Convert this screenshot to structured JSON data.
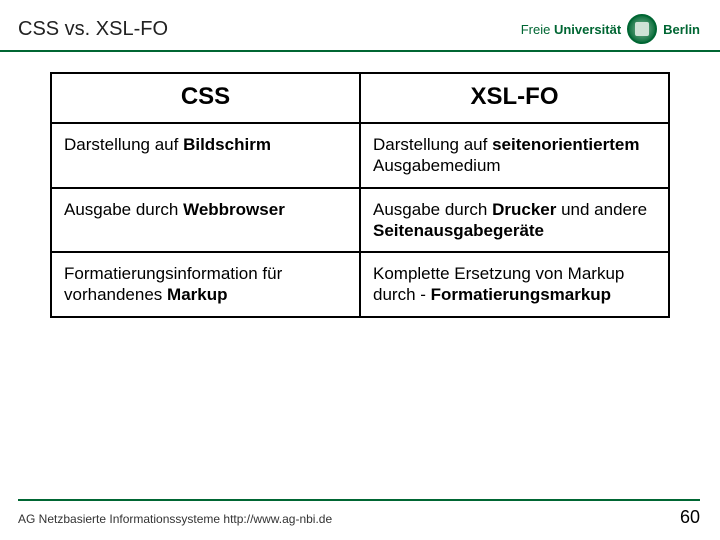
{
  "header": {
    "title": "CSS vs. XSL-FO",
    "logo_text_1": "Freie",
    "logo_text_2": "Universität",
    "logo_city": "Berlin"
  },
  "table": {
    "col1_header": "CSS",
    "col2_header": "XSL-FO",
    "rows": [
      {
        "c1_pre": "Darstellung auf ",
        "c1_b": "Bildschirm",
        "c1_post": "",
        "c2_pre": "Darstellung auf ",
        "c2_b": "seitenorientiertem",
        "c2_post": " Ausgabemedium"
      },
      {
        "c1_pre": "Ausgabe durch ",
        "c1_b": "Webbrowser",
        "c1_post": "",
        "c2_pre": "Ausgabe durch ",
        "c2_b": "Drucker",
        "c2_post": " und andere ",
        "c2_b2": "Seitenausgabegeräte"
      },
      {
        "c1_pre": "Formatierungsinformation für vorhandenes ",
        "c1_b": "Markup",
        "c1_post": "",
        "c2_pre": "Komplette Ersetzung von Markup durch - ",
        "c2_b": "Formatierungsmarkup",
        "c2_post": ""
      }
    ]
  },
  "footer": {
    "org": "AG Netzbasierte Informationssysteme http://www.ag-nbi.de",
    "page": "60"
  }
}
